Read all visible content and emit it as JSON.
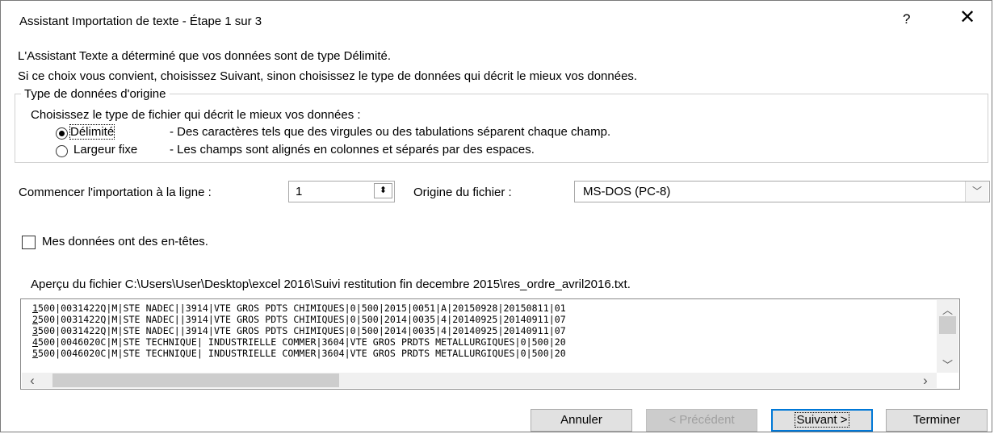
{
  "window": {
    "title": "Assistant Importation de texte - Étape 1 sur 3",
    "help": "?",
    "close": "✕"
  },
  "intro": {
    "line1": "L'Assistant Texte a déterminé que vos données sont de type Délimité.",
    "line2": "Si ce choix vous convient, choisissez Suivant, sinon choisissez le type de données qui décrit le mieux vos données."
  },
  "origin_group": {
    "legend": "Type de données d'origine",
    "prompt": "Choisissez le type de fichier qui décrit le mieux vos données :",
    "options": [
      {
        "label": "Délimité",
        "desc": "- Des caractères tels que des virgules ou des tabulations séparent chaque champ.",
        "checked": true
      },
      {
        "label": "Largeur fixe",
        "desc": "- Les champs sont alignés en colonnes et séparés par des espaces.",
        "checked": false
      }
    ]
  },
  "start_row": {
    "label": "Commencer l'importation à la ligne :",
    "value": "1"
  },
  "file_origin": {
    "label": "Origine du fichier :",
    "value": "MS-DOS (PC-8)"
  },
  "headers_checkbox": {
    "label": "Mes données ont des en-têtes.",
    "checked": false
  },
  "preview": {
    "label": "Aperçu du fichier C:\\Users\\User\\Desktop\\excel 2016\\Suivi restitution fin decembre 2015\\res_ordre_avril2016.txt.",
    "lines": [
      {
        "num": "1",
        "text": "500|0031422Q|M|STE NADEC||3914|VTE GROS PDTS CHIMIQUES|0|500|2015|0051|A|20150928|20150811|01"
      },
      {
        "num": "2",
        "text": "500|0031422Q|M|STE NADEC||3914|VTE GROS PDTS CHIMIQUES|0|500|2014|0035|4|20140925|20140911|07"
      },
      {
        "num": "3",
        "text": "500|0031422Q|M|STE NADEC||3914|VTE GROS PDTS CHIMIQUES|0|500|2014|0035|4|20140925|20140911|07"
      },
      {
        "num": "4",
        "text": "500|0046020C|M|STE TECHNIQUE| INDUSTRIELLE COMMER|3604|VTE GROS PRDTS METALLURGIQUES|0|500|20"
      },
      {
        "num": "5",
        "text": "500|0046020C|M|STE TECHNIQUE| INDUSTRIELLE COMMER|3604|VTE GROS PRDTS METALLURGIQUES|0|500|20"
      }
    ]
  },
  "buttons": {
    "cancel": "Annuler",
    "previous": "< Précédent",
    "next": "Suivant >",
    "finish": "Terminer"
  },
  "icons": {
    "spin": "⬍",
    "dropdown": "﹀",
    "up": "︿",
    "down": "﹀",
    "left": "‹",
    "right": "›"
  }
}
